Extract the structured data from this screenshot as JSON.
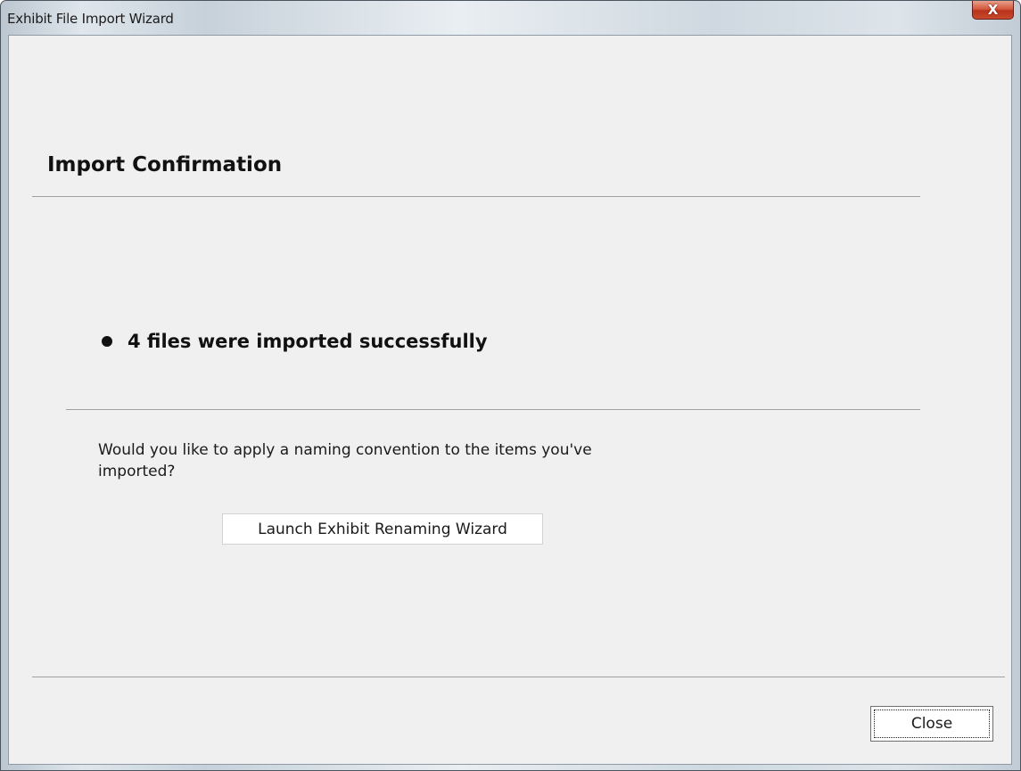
{
  "window": {
    "title": "Exhibit File Import Wizard",
    "close_glyph": "X",
    "close_icon": "close-icon"
  },
  "content": {
    "heading": "Import Confirmation",
    "result": "4 files were imported successfully",
    "question": "Would you like to apply a naming convention to the items you've imported?",
    "launch_button": "Launch Exhibit Renaming Wizard"
  },
  "footer": {
    "close_button": "Close"
  },
  "colors": {
    "client_background": "#f0f0f0",
    "close_button_red": "#c84a2c",
    "divider": "#a0a0a0"
  }
}
